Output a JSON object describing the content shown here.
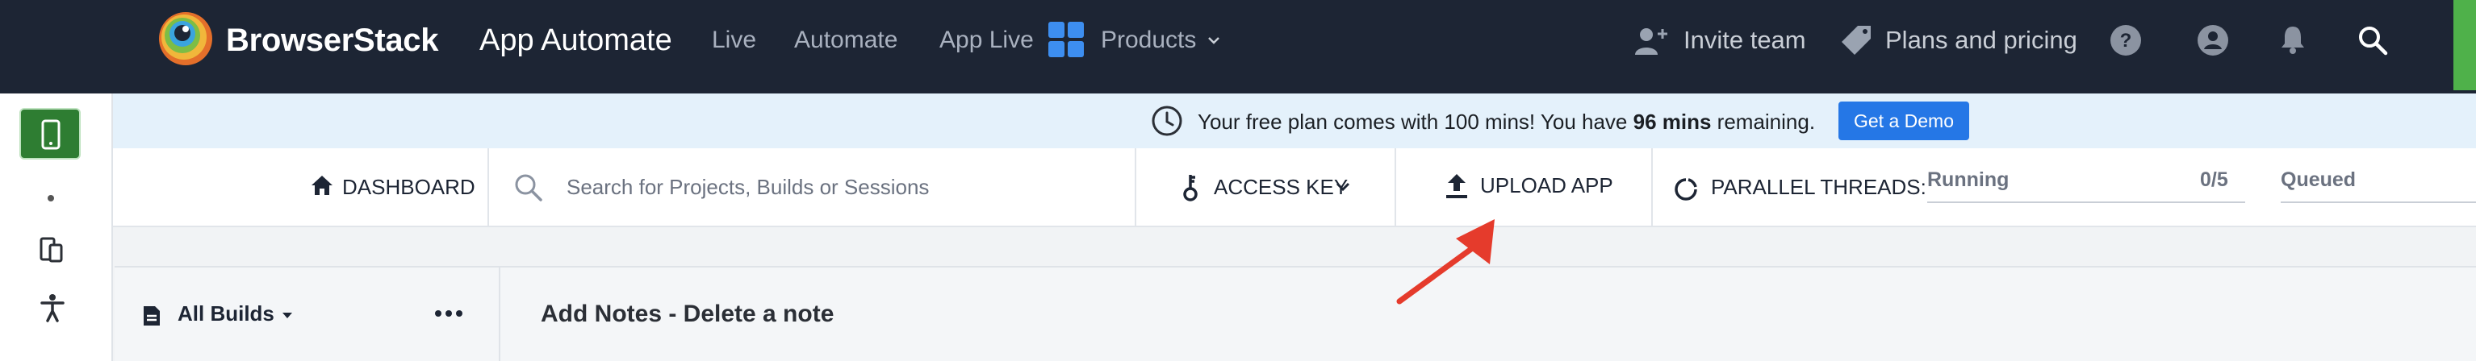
{
  "header": {
    "brand": "BrowserStack",
    "product": "App Automate",
    "nav_links": [
      "Live",
      "Automate",
      "App Live"
    ],
    "products_label": "Products",
    "invite_label": "Invite team",
    "plans_label": "Plans and pricing"
  },
  "banner": {
    "text_before": "Your free plan comes with 100 mins! You have ",
    "mins_bold": "96 mins",
    "text_after": " remaining.",
    "demo_button": "Get a Demo"
  },
  "toolbar": {
    "dashboard_label": "DASHBOARD",
    "search_placeholder": "Search for Projects, Builds or Sessions",
    "access_key_label": "ACCESS KEY",
    "upload_label": "UPLOAD APP",
    "parallel_label": "PARALLEL THREADS:",
    "running_label": "Running",
    "running_value": "0/5",
    "queued_label": "Queued"
  },
  "builds": {
    "filter_label": "All Builds"
  },
  "main": {
    "title": "Add Notes - Delete a note"
  },
  "colors": {
    "topbar": "#1d2534",
    "accent_blue": "#2577e6",
    "banner_bg": "#e4f1fb",
    "active_green": "#2e7d32",
    "annotation_red": "#e53b2c"
  }
}
